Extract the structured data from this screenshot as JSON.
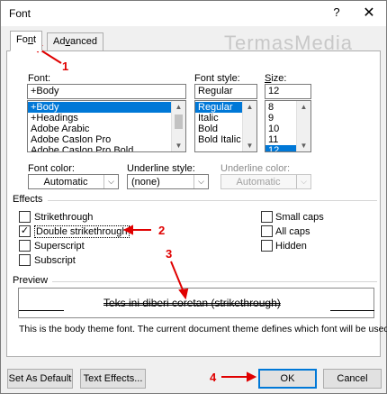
{
  "window": {
    "title": "Font",
    "help": "?",
    "close": "✕"
  },
  "tabs": [
    {
      "label": "Font",
      "ul": "n",
      "pre": "Fo",
      "post": "t"
    },
    {
      "label": "Advanced",
      "ul": "v",
      "pre": "Ad",
      "post": "anced"
    }
  ],
  "watermark": "TermasMedia",
  "font": {
    "label": "Font:",
    "value": "+Body",
    "list": [
      "+Body",
      "+Headings",
      "Adobe Arabic",
      "Adobe Caslon Pro",
      "Adobe Caslon Pro Bold"
    ],
    "selected_index": 0
  },
  "font_style": {
    "label": "Font style:",
    "value": "Regular",
    "list": [
      "Regular",
      "Italic",
      "Bold",
      "Bold Italic"
    ],
    "selected_index": 0
  },
  "size": {
    "label": "Size:",
    "value": "12",
    "list": [
      "8",
      "9",
      "10",
      "11",
      "12"
    ],
    "selected_index": 4
  },
  "font_color": {
    "label": "Font color:",
    "value": "Automatic"
  },
  "underline_style": {
    "label": "Underline style:",
    "value": "(none)"
  },
  "underline_color": {
    "label": "Underline color:",
    "value": "Automatic"
  },
  "effects": {
    "heading": "Effects",
    "left": [
      {
        "label": "Strikethrough",
        "checked": false
      },
      {
        "label": "Double strikethrough",
        "checked": true
      },
      {
        "label": "Superscript",
        "checked": false
      },
      {
        "label": "Subscript",
        "checked": false
      }
    ],
    "right": [
      {
        "label": "Small caps",
        "checked": false
      },
      {
        "label": "All caps",
        "checked": false
      },
      {
        "label": "Hidden",
        "checked": false
      }
    ],
    "check_glyph": "✓"
  },
  "preview": {
    "heading": "Preview",
    "sample": "Teks ini diberi coretan (strikethrough)",
    "note": "This is the body theme font. The current document theme defines which font will be used."
  },
  "buttons": {
    "set_default": "Set As Default",
    "text_effects": "Text Effects...",
    "ok": "OK",
    "cancel": "Cancel"
  },
  "annotations": [
    "1",
    "2",
    "3",
    "4"
  ],
  "colors": {
    "selection": "#0078d7",
    "annotation": "#e00000",
    "default_button_border": "#0078d7"
  }
}
